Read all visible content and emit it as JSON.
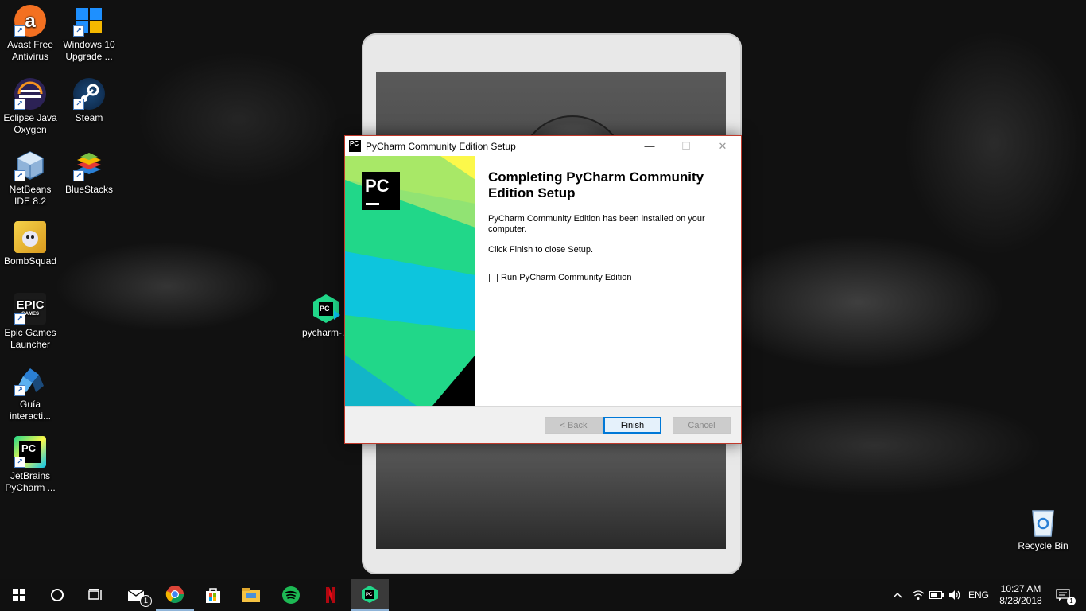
{
  "desktop": {
    "icons": [
      {
        "label": "Avast Free Antivirus",
        "icon": "avast-icon",
        "color": "#f37021"
      },
      {
        "label": "Windows 10 Upgrade ...",
        "icon": "windows-logo-icon",
        "color": "#1e90ff"
      },
      {
        "label": "Eclipse Java Oxygen",
        "icon": "eclipse-icon",
        "color": "#2c2255"
      },
      {
        "label": "Steam",
        "icon": "steam-icon",
        "color": "#1b4a7a"
      },
      {
        "label": "NetBeans IDE 8.2",
        "icon": "netbeans-icon",
        "color": "#8fb3d9"
      },
      {
        "label": "BlueStacks",
        "icon": "bluestacks-icon",
        "color": "#7ac143"
      },
      {
        "label": "BombSquad",
        "icon": "bombsquad-icon",
        "color": "#e8b32a"
      },
      {
        "label": "Epic Games Launcher",
        "icon": "epic-games-icon",
        "color": "#1a1a1a"
      },
      {
        "label": "Guía interacti...",
        "icon": "guide-icon",
        "color": "#2a7fd4"
      },
      {
        "label": "JetBrains PyCharm ...",
        "icon": "pycharm-icon",
        "color": "#21d789"
      },
      {
        "label": "pycharm-...",
        "icon": "pycharm-installer-icon",
        "color": "#21d789"
      },
      {
        "label": "Recycle Bin",
        "icon": "recycle-bin-icon",
        "color": "#cfe6f5"
      }
    ],
    "epic_text": "EPIC",
    "epic_sub": "GAMES",
    "pc_text": "PC"
  },
  "dialog": {
    "title": "PyCharm Community Edition Setup",
    "heading": "Completing PyCharm Community Edition Setup",
    "message": "PyCharm Community Edition has been installed on your computer.",
    "instruction": "Click Finish to close Setup.",
    "checkbox_label": "Run PyCharm Community Edition",
    "checkbox_checked": false,
    "logo_text": "PC",
    "buttons": {
      "back": "< Back",
      "finish": "Finish",
      "cancel": "Cancel"
    },
    "win_controls": {
      "minimize": "—",
      "maximize": "☐",
      "close": "✕"
    }
  },
  "taskbar": {
    "start_icon": "windows-start-icon",
    "mail_badge": "1",
    "pinned": [
      {
        "icon": "search-icon",
        "running": false
      },
      {
        "icon": "task-view-icon",
        "running": false
      },
      {
        "icon": "mail-icon",
        "running": false
      },
      {
        "icon": "chrome-icon",
        "running": true
      },
      {
        "icon": "store-icon",
        "running": false
      },
      {
        "icon": "file-explorer-icon",
        "running": false
      },
      {
        "icon": "spotify-icon",
        "running": false
      },
      {
        "icon": "netflix-icon",
        "running": false
      },
      {
        "icon": "pycharm-installer-icon",
        "running": true,
        "active": true
      }
    ],
    "tray": {
      "language": "ENG",
      "time": "10:27 AM",
      "date": "8/28/2018",
      "notification_count": "1"
    }
  }
}
